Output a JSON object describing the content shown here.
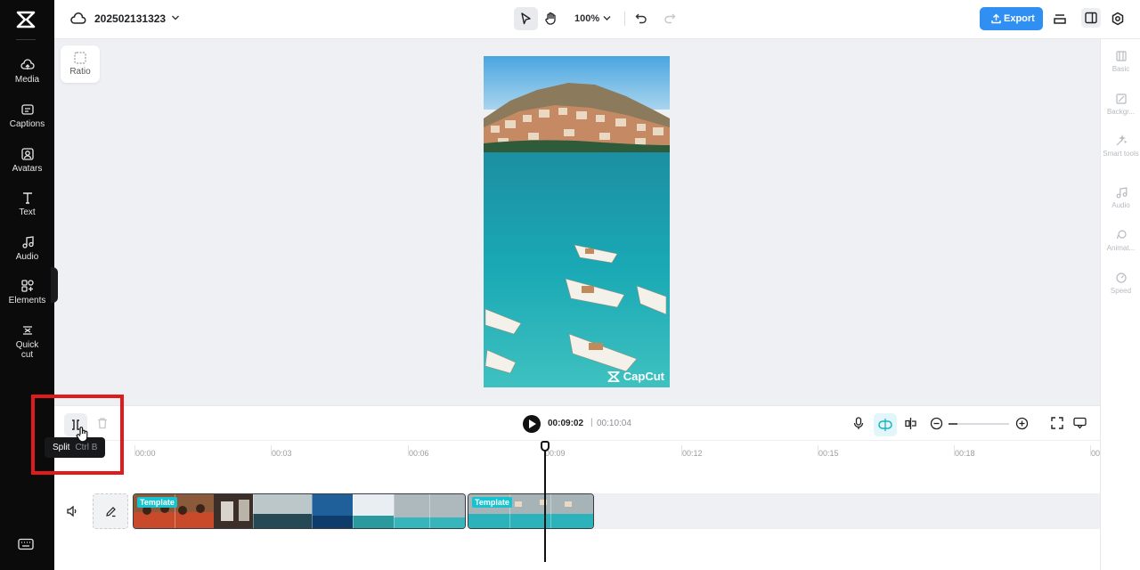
{
  "app": {
    "logo_icon": "capcut-logo-icon"
  },
  "sidebar": {
    "items": [
      {
        "label": "Media",
        "icon": "cloud-upload-icon"
      },
      {
        "label": "Captions",
        "icon": "captions-icon"
      },
      {
        "label": "Avatars",
        "icon": "avatar-icon"
      },
      {
        "label": "Text",
        "icon": "text-icon"
      },
      {
        "label": "Audio",
        "icon": "music-note-icon"
      },
      {
        "label": "Elements",
        "icon": "elements-icon"
      },
      {
        "label": "Quick cut",
        "icon": "quick-cut-icon"
      }
    ],
    "keyboard_icon": "keyboard-icon"
  },
  "topbar": {
    "project_title": "202502131323",
    "zoom_level": "100%",
    "export_label": "Export",
    "accent_color": "#2f8ff2"
  },
  "canvas": {
    "ratio_label": "Ratio",
    "watermark": "CapCut"
  },
  "right_panel": {
    "items": [
      {
        "label": "Basic",
        "icon": "basic-icon"
      },
      {
        "label": "Backgr...",
        "icon": "background-icon"
      },
      {
        "label": "Smart tools",
        "icon": "magic-wand-icon"
      },
      {
        "label": "Audio",
        "icon": "music-note-icon"
      },
      {
        "label": "Animat...",
        "icon": "animation-icon"
      },
      {
        "label": "Speed",
        "icon": "speed-icon"
      }
    ]
  },
  "timeline": {
    "tooltip_label": "Split",
    "tooltip_shortcut": "Ctrl B",
    "current_time": "00:09:02",
    "separator": "|",
    "total_time": "00:10:04",
    "ruler": [
      "00:00",
      "00:03",
      "00:06",
      "00:09",
      "00:12",
      "00:15",
      "00:18",
      "00"
    ],
    "clips": [
      {
        "label": "Template"
      },
      {
        "label": "Template"
      }
    ],
    "highlight_color": "#e01b1b"
  }
}
